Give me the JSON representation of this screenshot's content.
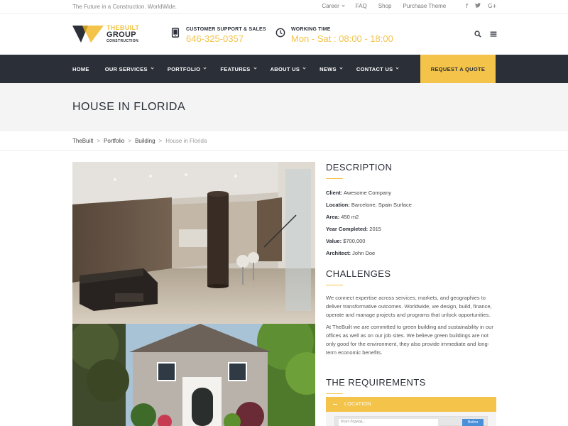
{
  "topbar": {
    "tagline": "The Future in a Construction. WorldWide.",
    "links": [
      "Career",
      "FAQ",
      "Shop",
      "Purchase Theme"
    ],
    "social": [
      "f",
      "t",
      "G+"
    ]
  },
  "logo": {
    "line1": "THEBUILT",
    "line2": "GROUP",
    "line3": "CONSTRUCTION"
  },
  "support": {
    "label": "CUSTOMER SUPPORT & SALES",
    "value": "646-325-0357"
  },
  "working": {
    "label": "WORKING TIME",
    "value": "Mon - Sat : 08:00 - 18:00"
  },
  "nav": {
    "items": [
      "HOME",
      "OUR SERVICES",
      "PORTFOLIO",
      "FEATURES",
      "ABOUT US",
      "NEWS",
      "CONTACT US"
    ],
    "quote": "REQUEST A QUOTE"
  },
  "page": {
    "title": "HOUSE IN FLORIDA"
  },
  "breadcrumb": [
    "TheBuilt",
    "Portfolio",
    "Building",
    "House in Florida"
  ],
  "description": {
    "title": "DESCRIPTION",
    "rows": [
      {
        "k": "Client:",
        "v": "Awesome Company"
      },
      {
        "k": "Location:",
        "v": "Barcelone, Spain Surface"
      },
      {
        "k": "Area:",
        "v": "450 m2"
      },
      {
        "k": "Year Completed:",
        "v": "2015"
      },
      {
        "k": "Value:",
        "v": "$700,000"
      },
      {
        "k": "Architect:",
        "v": "John Doe"
      }
    ]
  },
  "challenges": {
    "title": "CHALLENGES",
    "p1": "We connect expertise across services, markets, and geographies to deliver transformative outcomes. Worldwide, we design, build, finance, operate and manage projects and programs that unlock opportunities.",
    "p2": "At TheBuilt we are committed to green building and sustainability in our offices as well as on our job sites. We believe green buildings are not only good for the environment, they also provide immediate and long-term economic benefits."
  },
  "requirements": {
    "title": "THE REQUIREMENTS",
    "location_label": "LOCATION"
  },
  "map": {
    "field": "Форт-Лодерд...",
    "button": "Войти"
  },
  "colors": {
    "accent": "#f3c34a",
    "dark": "#2b2f38"
  }
}
